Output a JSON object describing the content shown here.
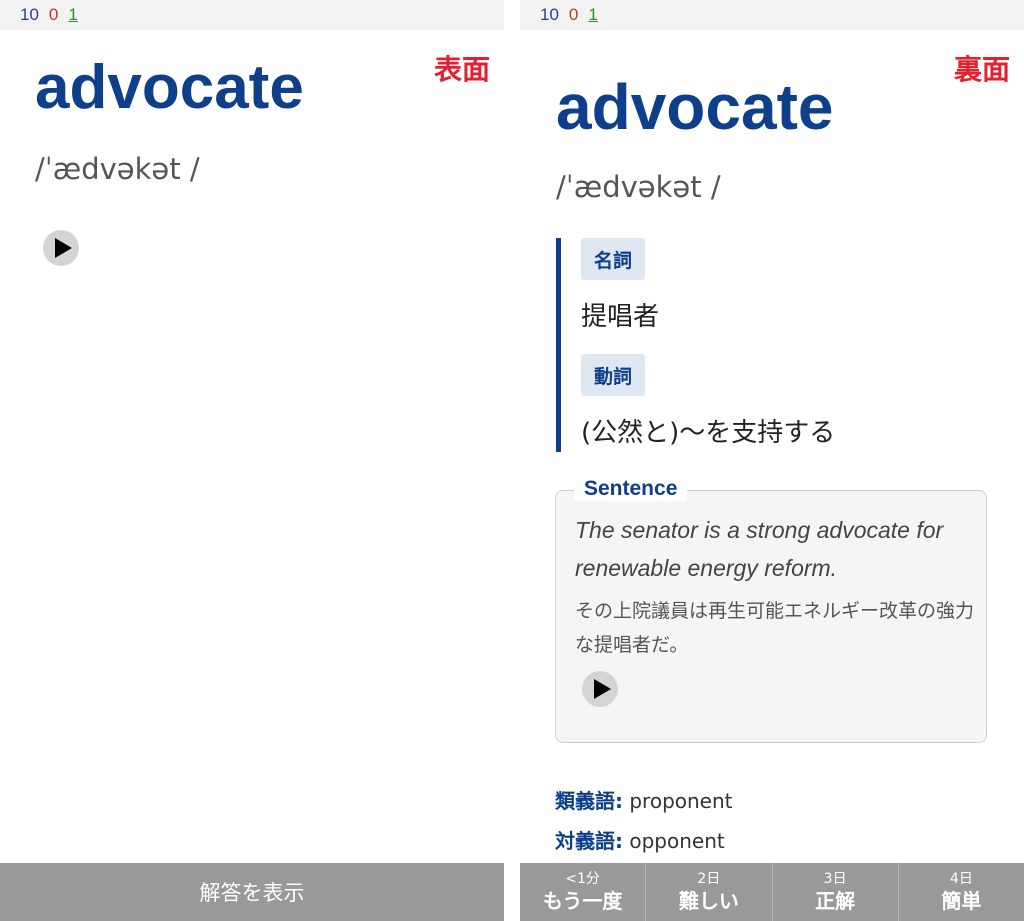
{
  "counts": {
    "new": "10",
    "learning": "0",
    "review": "1"
  },
  "front": {
    "side_label": "表面",
    "word": "advocate",
    "pronunciation": "/ˈædvəkət /",
    "play_icon": "play-icon",
    "show_answer": "解答を表示"
  },
  "back": {
    "side_label": "裏面",
    "word": "advocate",
    "pronunciation": "/ˈædvəkət /",
    "meanings": [
      {
        "pos": "名詞",
        "text": "提唱者"
      },
      {
        "pos": "動詞",
        "text": "(公然と)〜を支持する"
      }
    ],
    "sentence": {
      "title": "Sentence",
      "english": "The senator is a strong advocate for renewable energy reform.",
      "japanese": "その上院議員は再生可能エネルギー改革の強力な提唱者だ。"
    },
    "synonym_label": "類義語:",
    "synonym": "proponent",
    "antonym_label": "対義語:",
    "antonym": "opponent",
    "answers": [
      {
        "time": "<1分",
        "label": "もう一度"
      },
      {
        "time": "2日",
        "label": "難しい"
      },
      {
        "time": "3日",
        "label": "正解"
      },
      {
        "time": "4日",
        "label": "簡単"
      }
    ]
  },
  "colors": {
    "accent": "#0d3f8a",
    "side_label": "#e5202e",
    "button_bg": "#999999"
  }
}
